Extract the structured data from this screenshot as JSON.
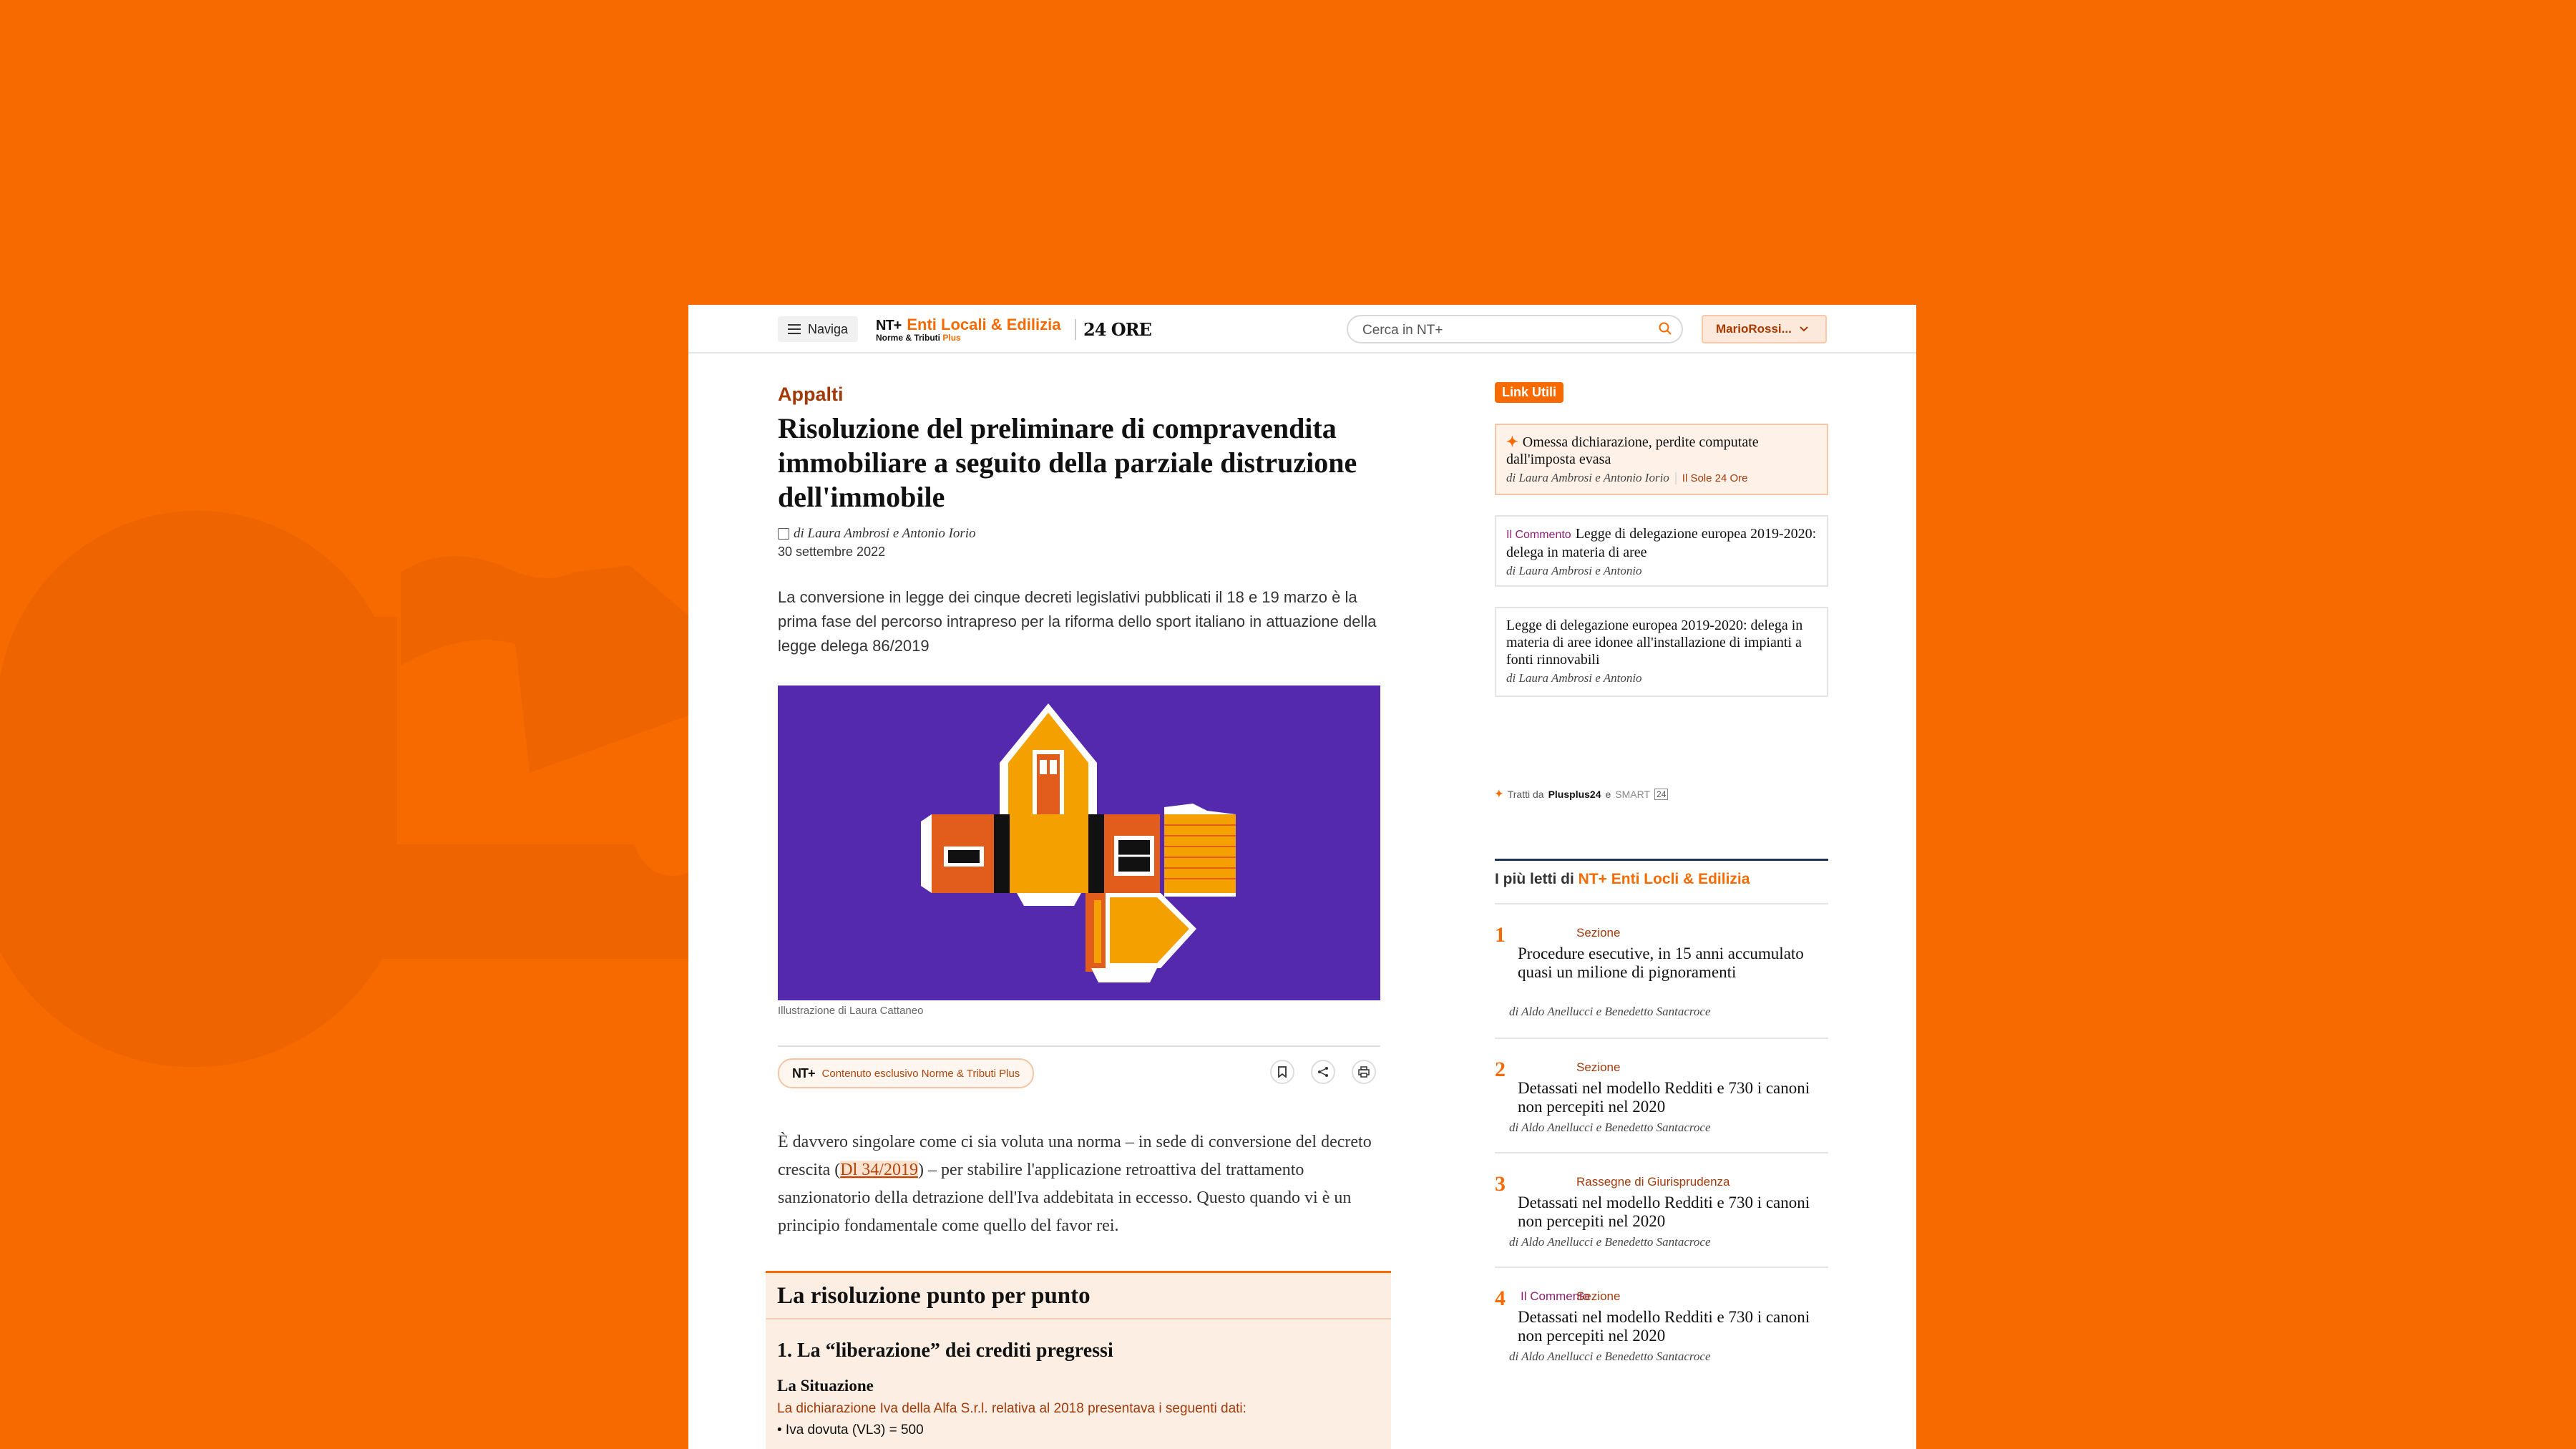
{
  "header": {
    "nav_label": "Naviga",
    "logo_nt": "NT+",
    "logo_section": "Enti Locali & Edilizia",
    "logo_sub": "Norme & Tributi",
    "logo_sub_plus": "Plus",
    "logo_sole": "24 ORE",
    "search_placeholder": "Cerca in NT+",
    "user_label": "MarioRossi..."
  },
  "article": {
    "kicker": "Appalti",
    "title": "Risoluzione del preliminare di compravendita immobiliare a seguito della parziale distruzione dell'immobile",
    "byline": "di Laura Ambrosi e Antonio Iorio",
    "date": "30 settembre 2022",
    "summary": "La conversione in legge dei cinque decreti legislativi pubblicati il 18 e 19 marzo è la prima fase del percorso intrapreso per la riforma dello sport italiano in attuazione della legge delega 86/2019",
    "image_caption": "Illustrazione di Laura Cattaneo",
    "exclusive_badge": "NT+",
    "exclusive_text": "Contenuto esclusivo Norme & Tributi Plus",
    "body_before": "È davvero singolare come ci sia voluta una norma – in sede di conversione del decreto crescita (",
    "body_link": "Dl 34/2019",
    "body_after": ") – per stabilire l'applicazione retroattiva del trattamento sanzionatorio della detrazione dell'Iva addebitata in eccesso. Questo quando vi è un principio fondamentale come quello del favor rei.",
    "box": {
      "title": "La  risoluzione punto per punto",
      "subtitle": "1. La “liberazione” dei crediti pregressi",
      "situation_label": "La Situazione",
      "line1": "La dichiarazione Iva della Alfa S.r.l. relativa al 2018 presentava i seguenti dati:",
      "line2": "• Iva dovuta (VL3) = 500"
    }
  },
  "sidebar": {
    "badge": "Link Utili",
    "cards": [
      {
        "tag": "",
        "title": "Omessa dichiarazione, perdite computate dall'imposta evasa",
        "authors": "di Laura Ambrosi e Antonio Iorio",
        "source": "Il Sole 24 Ore"
      },
      {
        "tag": "Il Commento",
        "title": "Legge di delegazione europea 2019-2020: delega in materia di aree",
        "authors": "di Laura Ambrosi e Antonio",
        "source": ""
      },
      {
        "tag": "",
        "title": "Legge di delegazione europea 2019-2020: delega in materia di aree idonee all'installazione di impianti a fonti rinnovabili",
        "authors": "di Laura Ambrosi e Antonio",
        "source": ""
      }
    ],
    "tratti_prefix": "Tratti da",
    "tratti_brand": "Plusplus24",
    "tratti_and": "e",
    "tratti_smart": "SMART",
    "tratti_24": "24",
    "most_read_prefix": "I più letti di",
    "most_read_brand": "NT+ Enti Locli & Edilizia",
    "most_read": [
      {
        "num": "1",
        "tag": "",
        "section": "Sezione",
        "title": "Procedure esecutive, in 15 anni accumulato quasi un milione di pignoramenti",
        "authors": "di Aldo Anellucci e Benedetto Santacroce"
      },
      {
        "num": "2",
        "tag": "",
        "section": "Sezione",
        "title": "Detassati nel modello Redditi e 730 i canoni non percepiti nel 2020",
        "authors": "di Aldo Anellucci e Benedetto Santacroce"
      },
      {
        "num": "3",
        "tag": "",
        "section": "Rassegne di Giurisprudenza",
        "title": "Detassati nel modello Redditi e 730 i canoni non percepiti nel 2020",
        "authors": "di Aldo Anellucci e Benedetto Santacroce"
      },
      {
        "num": "4",
        "tag": "Il Commento",
        "section": "Sezione",
        "title": "Detassati nel modello Redditi e 730 i canoni non percepiti nel 2020",
        "authors": "di Aldo Anellucci e Benedetto Santacroce"
      }
    ]
  },
  "colors": {
    "brand": "#f76a00",
    "hero_bg": "#5429ad"
  }
}
